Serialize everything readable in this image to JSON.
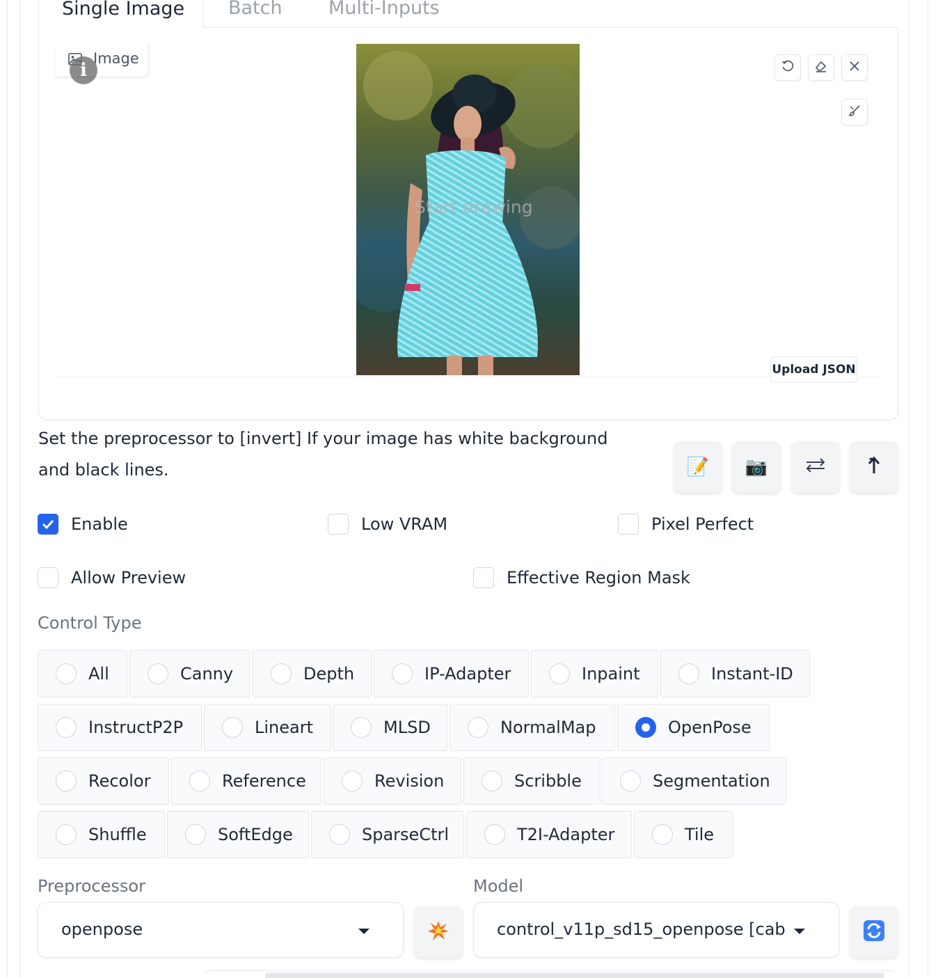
{
  "tabs": [
    {
      "label": "Single Image",
      "active": true
    },
    {
      "label": "Batch",
      "active": false
    },
    {
      "label": "Multi-Inputs",
      "active": false
    }
  ],
  "image_panel": {
    "label": "Image",
    "placeholder": "Start drawing",
    "upload_json_label": "Upload JSON",
    "tools": [
      "undo-icon",
      "eraser-icon",
      "close-icon",
      "brush-icon"
    ]
  },
  "hint_text": "Set the preprocessor to [invert] If your image has white background and black lines.",
  "action_buttons": [
    "notepad-icon",
    "camera-icon",
    "swap-icon",
    "send-up-icon"
  ],
  "checkboxes": {
    "enable": {
      "label": "Enable",
      "checked": true
    },
    "low_vram": {
      "label": "Low VRAM",
      "checked": false
    },
    "pixel_perfect": {
      "label": "Pixel Perfect",
      "checked": false
    },
    "allow_preview": {
      "label": "Allow Preview",
      "checked": false
    },
    "effective_region_mask": {
      "label": "Effective Region Mask",
      "checked": false
    }
  },
  "control_type": {
    "label": "Control Type",
    "selected": "OpenPose",
    "options": [
      "All",
      "Canny",
      "Depth",
      "IP-Adapter",
      "Inpaint",
      "Instant-ID",
      "InstructP2P",
      "Lineart",
      "MLSD",
      "NormalMap",
      "OpenPose",
      "Recolor",
      "Reference",
      "Revision",
      "Scribble",
      "Segmentation",
      "Shuffle",
      "SoftEdge",
      "SparseCtrl",
      "T2I-Adapter",
      "Tile"
    ]
  },
  "preprocessor": {
    "label": "Preprocessor",
    "value": "openpose"
  },
  "model": {
    "label": "Model",
    "value": "control_v11p_sd15_openpose [cab"
  },
  "colors": {
    "accent": "#2563eb",
    "border": "#e5e7eb",
    "muted_text": "#6b7280"
  }
}
